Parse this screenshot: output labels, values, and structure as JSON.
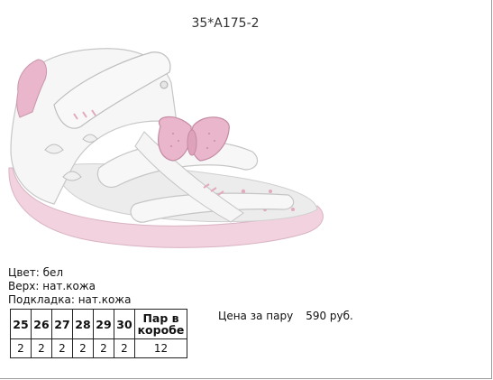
{
  "product": {
    "article": "35*A175-2",
    "image_alt": "white-pink-children-sandal"
  },
  "attributes": [
    {
      "label": "Цвет:",
      "value": "бел"
    },
    {
      "label": "Верх:",
      "value": "нат.кожа"
    },
    {
      "label": "Подкладка:",
      "value": "нат.кожа"
    }
  ],
  "size_table": {
    "sizes": [
      "25",
      "26",
      "27",
      "28",
      "29",
      "30"
    ],
    "quantities": [
      "2",
      "2",
      "2",
      "2",
      "2",
      "2"
    ],
    "pairs_header_line1": "Пар в",
    "pairs_header_line2": "коробе",
    "pairs_total": "12"
  },
  "price": {
    "label": "Цена за пару",
    "value": "590 руб."
  },
  "colors": {
    "shoe_white": "#f4f4f4",
    "accent_pink": "#e9b6cb",
    "sole_pink": "#f1d2de"
  }
}
